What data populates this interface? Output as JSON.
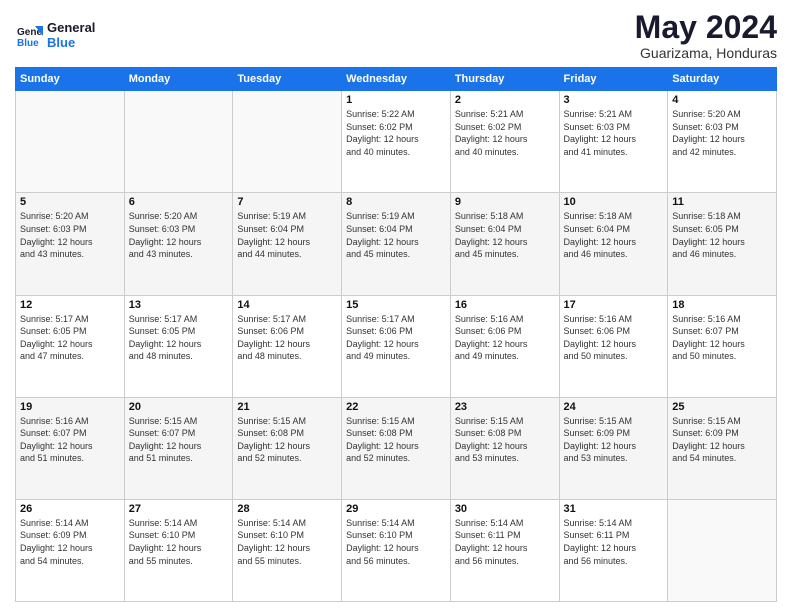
{
  "logo": {
    "line1": "General",
    "line2": "Blue"
  },
  "calendar": {
    "title": "May 2024",
    "subtitle": "Guarizama, Honduras"
  },
  "weekdays": [
    "Sunday",
    "Monday",
    "Tuesday",
    "Wednesday",
    "Thursday",
    "Friday",
    "Saturday"
  ],
  "weeks": [
    [
      {
        "day": "",
        "info": ""
      },
      {
        "day": "",
        "info": ""
      },
      {
        "day": "",
        "info": ""
      },
      {
        "day": "1",
        "info": "Sunrise: 5:22 AM\nSunset: 6:02 PM\nDaylight: 12 hours\nand 40 minutes."
      },
      {
        "day": "2",
        "info": "Sunrise: 5:21 AM\nSunset: 6:02 PM\nDaylight: 12 hours\nand 40 minutes."
      },
      {
        "day": "3",
        "info": "Sunrise: 5:21 AM\nSunset: 6:03 PM\nDaylight: 12 hours\nand 41 minutes."
      },
      {
        "day": "4",
        "info": "Sunrise: 5:20 AM\nSunset: 6:03 PM\nDaylight: 12 hours\nand 42 minutes."
      }
    ],
    [
      {
        "day": "5",
        "info": "Sunrise: 5:20 AM\nSunset: 6:03 PM\nDaylight: 12 hours\nand 43 minutes."
      },
      {
        "day": "6",
        "info": "Sunrise: 5:20 AM\nSunset: 6:03 PM\nDaylight: 12 hours\nand 43 minutes."
      },
      {
        "day": "7",
        "info": "Sunrise: 5:19 AM\nSunset: 6:04 PM\nDaylight: 12 hours\nand 44 minutes."
      },
      {
        "day": "8",
        "info": "Sunrise: 5:19 AM\nSunset: 6:04 PM\nDaylight: 12 hours\nand 45 minutes."
      },
      {
        "day": "9",
        "info": "Sunrise: 5:18 AM\nSunset: 6:04 PM\nDaylight: 12 hours\nand 45 minutes."
      },
      {
        "day": "10",
        "info": "Sunrise: 5:18 AM\nSunset: 6:04 PM\nDaylight: 12 hours\nand 46 minutes."
      },
      {
        "day": "11",
        "info": "Sunrise: 5:18 AM\nSunset: 6:05 PM\nDaylight: 12 hours\nand 46 minutes."
      }
    ],
    [
      {
        "day": "12",
        "info": "Sunrise: 5:17 AM\nSunset: 6:05 PM\nDaylight: 12 hours\nand 47 minutes."
      },
      {
        "day": "13",
        "info": "Sunrise: 5:17 AM\nSunset: 6:05 PM\nDaylight: 12 hours\nand 48 minutes."
      },
      {
        "day": "14",
        "info": "Sunrise: 5:17 AM\nSunset: 6:06 PM\nDaylight: 12 hours\nand 48 minutes."
      },
      {
        "day": "15",
        "info": "Sunrise: 5:17 AM\nSunset: 6:06 PM\nDaylight: 12 hours\nand 49 minutes."
      },
      {
        "day": "16",
        "info": "Sunrise: 5:16 AM\nSunset: 6:06 PM\nDaylight: 12 hours\nand 49 minutes."
      },
      {
        "day": "17",
        "info": "Sunrise: 5:16 AM\nSunset: 6:06 PM\nDaylight: 12 hours\nand 50 minutes."
      },
      {
        "day": "18",
        "info": "Sunrise: 5:16 AM\nSunset: 6:07 PM\nDaylight: 12 hours\nand 50 minutes."
      }
    ],
    [
      {
        "day": "19",
        "info": "Sunrise: 5:16 AM\nSunset: 6:07 PM\nDaylight: 12 hours\nand 51 minutes."
      },
      {
        "day": "20",
        "info": "Sunrise: 5:15 AM\nSunset: 6:07 PM\nDaylight: 12 hours\nand 51 minutes."
      },
      {
        "day": "21",
        "info": "Sunrise: 5:15 AM\nSunset: 6:08 PM\nDaylight: 12 hours\nand 52 minutes."
      },
      {
        "day": "22",
        "info": "Sunrise: 5:15 AM\nSunset: 6:08 PM\nDaylight: 12 hours\nand 52 minutes."
      },
      {
        "day": "23",
        "info": "Sunrise: 5:15 AM\nSunset: 6:08 PM\nDaylight: 12 hours\nand 53 minutes."
      },
      {
        "day": "24",
        "info": "Sunrise: 5:15 AM\nSunset: 6:09 PM\nDaylight: 12 hours\nand 53 minutes."
      },
      {
        "day": "25",
        "info": "Sunrise: 5:15 AM\nSunset: 6:09 PM\nDaylight: 12 hours\nand 54 minutes."
      }
    ],
    [
      {
        "day": "26",
        "info": "Sunrise: 5:14 AM\nSunset: 6:09 PM\nDaylight: 12 hours\nand 54 minutes."
      },
      {
        "day": "27",
        "info": "Sunrise: 5:14 AM\nSunset: 6:10 PM\nDaylight: 12 hours\nand 55 minutes."
      },
      {
        "day": "28",
        "info": "Sunrise: 5:14 AM\nSunset: 6:10 PM\nDaylight: 12 hours\nand 55 minutes."
      },
      {
        "day": "29",
        "info": "Sunrise: 5:14 AM\nSunset: 6:10 PM\nDaylight: 12 hours\nand 56 minutes."
      },
      {
        "day": "30",
        "info": "Sunrise: 5:14 AM\nSunset: 6:11 PM\nDaylight: 12 hours\nand 56 minutes."
      },
      {
        "day": "31",
        "info": "Sunrise: 5:14 AM\nSunset: 6:11 PM\nDaylight: 12 hours\nand 56 minutes."
      },
      {
        "day": "",
        "info": ""
      }
    ]
  ]
}
